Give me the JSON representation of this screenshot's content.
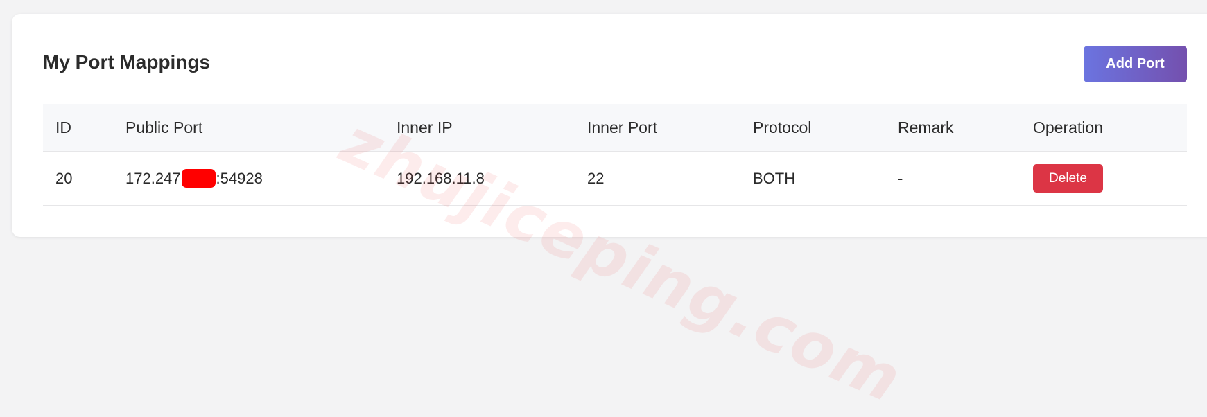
{
  "page": {
    "title": "My Port Mappings",
    "add_button_label": "Add Port"
  },
  "table": {
    "headers": [
      "ID",
      "Public Port",
      "Inner IP",
      "Inner Port",
      "Protocol",
      "Remark",
      "Operation"
    ],
    "rows": [
      {
        "id": "20",
        "public_port_prefix": "172.247",
        "public_port_suffix": ":54928",
        "inner_ip": "192.168.11.8",
        "inner_port": "22",
        "protocol": "BOTH",
        "remark": "-",
        "delete_label": "Delete"
      }
    ]
  },
  "watermark": "zhujiceping.com",
  "colors": {
    "delete": "#dc3545",
    "add_gradient_start": "#6b74e0",
    "add_gradient_end": "#7450ae",
    "redaction": "#ff0000"
  }
}
